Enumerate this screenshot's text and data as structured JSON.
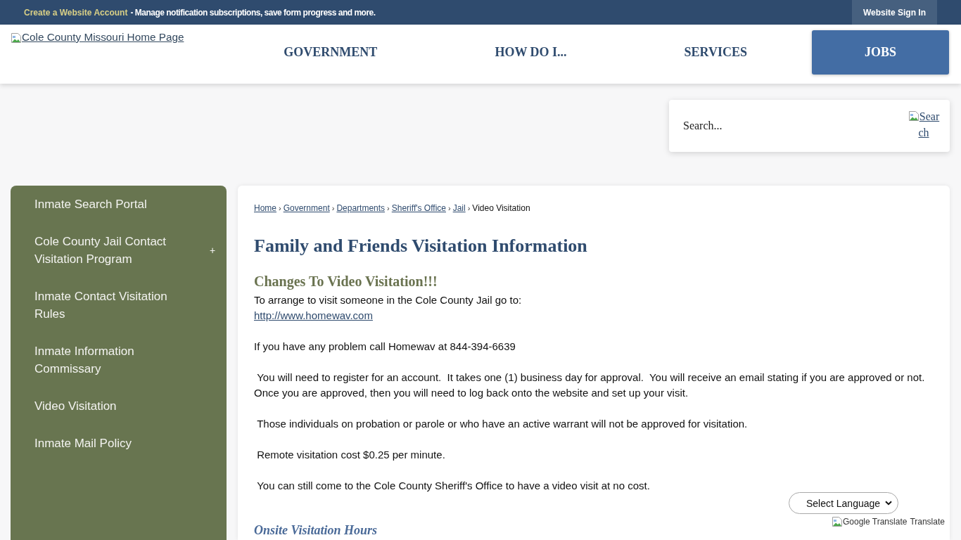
{
  "top_bar": {
    "account_link": "Create a Website Account",
    "message": "- Manage notification subscriptions, save form progress and more.",
    "sign_in_button": "Website Sign In"
  },
  "header": {
    "logo_alt": "Cole County Missouri Home Page",
    "nav": [
      {
        "label": "GOVERNMENT",
        "highlighted": false
      },
      {
        "label": "HOW DO I...",
        "highlighted": false
      },
      {
        "label": "SERVICES",
        "highlighted": false
      },
      {
        "label": "JOBS",
        "highlighted": true
      }
    ]
  },
  "search": {
    "placeholder": "Search...",
    "button_alt": "Search"
  },
  "sidebar": {
    "items": [
      {
        "label": "Inmate Search Portal"
      },
      {
        "label": "Cole County Jail Contact Visitation Program",
        "toggle": "+"
      },
      {
        "label": "Inmate Contact Visitation Rules"
      },
      {
        "label": "Inmate Information Commissary"
      },
      {
        "label": "Video Visitation"
      },
      {
        "label": "Inmate Mail Policy"
      }
    ]
  },
  "breadcrumb": [
    {
      "label": "Home",
      "kind": "link"
    },
    {
      "label": "Government",
      "kind": "link",
      "separator": "›"
    },
    {
      "label": "Departments",
      "kind": "link",
      "separator": "›"
    },
    {
      "label": "Sheriff's Office",
      "kind": "link",
      "separator": "›"
    },
    {
      "label": "Jail",
      "kind": "link",
      "separator": "›"
    },
    {
      "label": "Video Visitation",
      "kind": "current",
      "separator": "›"
    }
  ],
  "content": {
    "title": "Family and Friends Visitation Information",
    "subtitle": "Changes To Video Visitation!!!",
    "paragraphs": [
      {
        "text": "To arrange to visit someone in the Cole County Jail go to:",
        "link": "http://www.homewav.com"
      },
      {
        "text": "If you have any problem call Homewav at 844-394-6639"
      },
      {
        "text": " You will need to register for an account.  It takes one (1) business day for approval.  You will receive an email stating if you are approved or not.  Once you are approved, then you will need to log back onto the website and set up your visit."
      },
      {
        "text": " Those individuals on probation or parole or who have an active warrant will not be approved for visitation."
      },
      {
        "text": " Remote visitation cost $0.25 per minute."
      },
      {
        "text": " You can still come to the Cole County Sheriff's Office to have a video visit at no cost."
      }
    ],
    "section_heading": "Onsite Visitation Hours"
  },
  "translate": {
    "select_label": "Select Language",
    "image_alt": "Google Translate",
    "link": "Translate"
  }
}
